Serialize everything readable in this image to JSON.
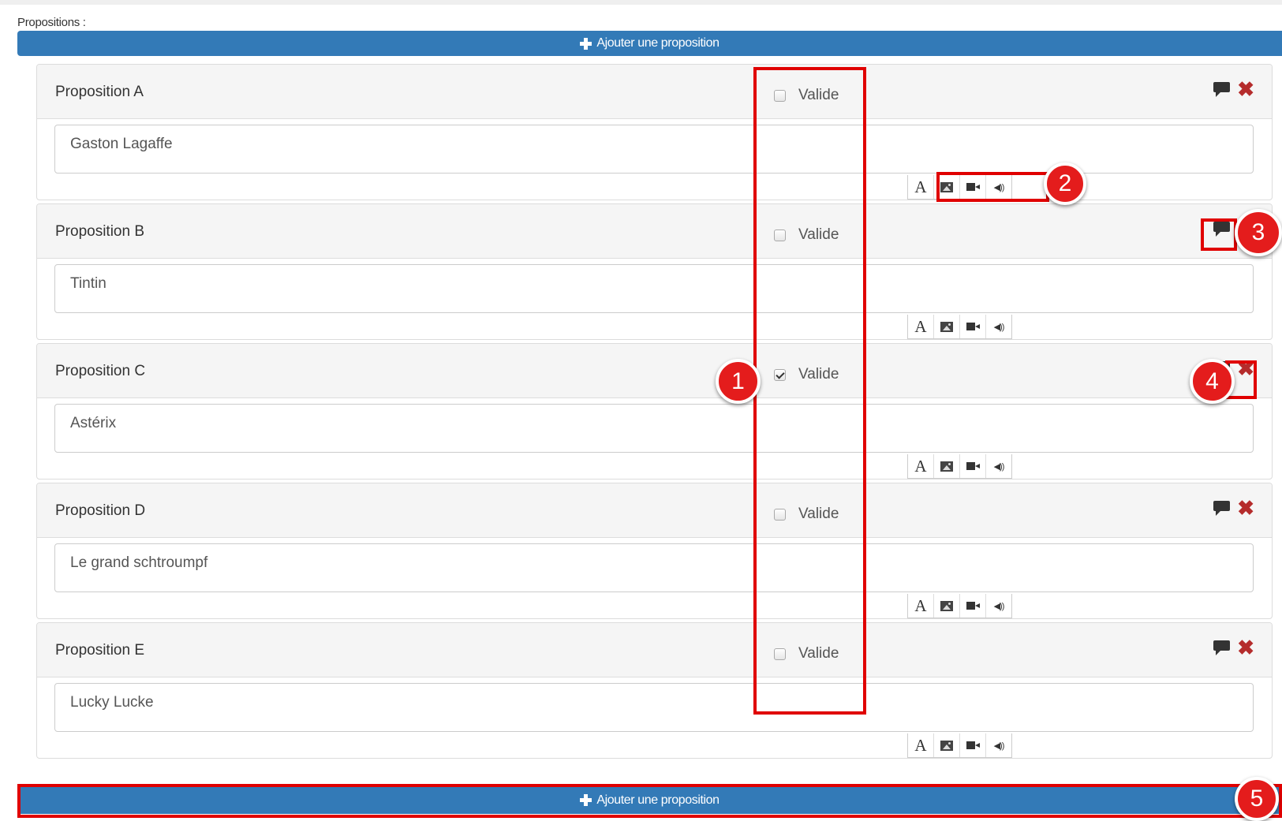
{
  "section": {
    "label": "Propositions :"
  },
  "add_button": {
    "label": "Ajouter une proposition",
    "icon": "plus-icon"
  },
  "valid_label": "Valide",
  "propositions": [
    {
      "title": "Proposition A",
      "value": "Gaston Lagaffe",
      "valid": false
    },
    {
      "title": "Proposition B",
      "value": "Tintin",
      "valid": false
    },
    {
      "title": "Proposition C",
      "value": "Astérix",
      "valid": true
    },
    {
      "title": "Proposition D",
      "value": "Le grand schtroumpf",
      "valid": false
    },
    {
      "title": "Proposition E",
      "value": "Lucky Lucke",
      "valid": false
    }
  ],
  "toolbar": {
    "text_label": "A",
    "icons": [
      "text-icon",
      "image-icon",
      "video-icon",
      "sound-icon"
    ]
  },
  "annotations": [
    "1",
    "2",
    "3",
    "4",
    "5"
  ],
  "colors": {
    "primary": "#337ab7",
    "danger": "#b52c2c",
    "highlight": "#e00000"
  }
}
